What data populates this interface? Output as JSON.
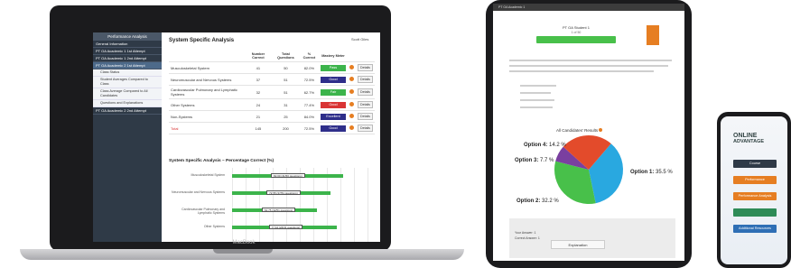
{
  "colors": {
    "pass": "#3cb44b",
    "good": "#2e2e8a",
    "fair": "#3cb44b",
    "excellent": "#2e2e8a",
    "red": "#d93535",
    "orange": "#e67e22",
    "navy": "#2f3a47"
  },
  "laptop": {
    "brand": "MacBook",
    "sidebar_header": "Performance Analysis",
    "sidebar_items": [
      {
        "label": "General Information",
        "active": false
      },
      {
        "label": "PT OA Academic 1 1st Attempt",
        "active": false
      },
      {
        "label": "PT OA Academic 1 2nd Attempt",
        "active": false
      },
      {
        "label": "PT OA Academic 2 1st Attempt",
        "active": true
      }
    ],
    "sidebar_subitems": [
      "Class Status",
      "Student Averages Compared to Class",
      "Class Average Compared to All Candidates",
      "Questions and Explanations"
    ],
    "sidebar_items_bottom": [
      {
        "label": "PT OA Academic 2 2nd Attempt"
      }
    ],
    "title": "System Specific Analysis",
    "user": "Scott Giles",
    "table": {
      "headers": [
        "",
        "Number Correct",
        "Total Questions",
        "% Correct",
        "Mastery Meter",
        "",
        ""
      ],
      "rows": [
        {
          "system": "Musculoskeletal System",
          "correct": "41",
          "total": "50",
          "pct": "82.0%",
          "mastery": "Pass",
          "color": "#3cb44b",
          "details": "Details"
        },
        {
          "system": "Neuromuscular and Nervous Systems",
          "correct": "37",
          "total": "51",
          "pct": "72.5%",
          "mastery": "Good",
          "color": "#2e2e8a",
          "details": "Details"
        },
        {
          "system": "Cardiovascular Pulmonary and Lymphatic Systems",
          "correct": "32",
          "total": "51",
          "pct": "62.7%",
          "mastery": "Fair",
          "color": "#3cb44b",
          "details": "Details"
        },
        {
          "system": "Other Systems",
          "correct": "24",
          "total": "31",
          "pct": "77.4%",
          "mastery": "Good",
          "color": "#d93535",
          "details": "Details"
        },
        {
          "system": "Non-Systems",
          "correct": "21",
          "total": "25",
          "pct": "84.0%",
          "mastery": "Excellent",
          "color": "#2e2e8a",
          "details": "Details"
        },
        {
          "system": "Total",
          "correct": "145",
          "total": "200",
          "pct": "72.5%",
          "mastery": "Good",
          "color": "#2e2e8a",
          "details": "Details",
          "total_row": true
        }
      ]
    },
    "bar_section_title": "System Specific Analysis – Percentage Correct (%)",
    "bars": [
      {
        "label": "Musculoskeletal System",
        "value": 82,
        "tag": "82.00 (41/50 questions)"
      },
      {
        "label": "Neuromuscular and Nervous Systems",
        "value": 72.5,
        "tag": "72.55 (37/51 questions)"
      },
      {
        "label": "Cardiovascular Pulmonary and Lymphatic Systems",
        "value": 62.7,
        "tag": "62.75 (32/51 questions)"
      },
      {
        "label": "Other Systems",
        "value": 77.4,
        "tag": "77.42 (24/31 questions)"
      }
    ]
  },
  "tablet": {
    "header_text": "PT OA Academic 1",
    "question_title": "PT OA Student 1",
    "question_sub": "1 of 50",
    "results_title": "All Candidates' Results",
    "pie": [
      {
        "label": "Option 1",
        "pct": 35.5,
        "display": "35.5 %",
        "color": "#29a8e0"
      },
      {
        "label": "Option 2",
        "pct": 32.2,
        "display": "32.2 %",
        "color": "#48c04a"
      },
      {
        "label": "Option 3",
        "pct": 7.7,
        "display": "7.7 %",
        "color": "#7a3fa0"
      },
      {
        "label": "Option 4",
        "pct": 24.6,
        "display": "14.2 %",
        "color": "#e34b2b"
      }
    ],
    "panel_lines": [
      "Your Answer: 1",
      "Correct Answer: 1"
    ],
    "panel_button": "Explanation"
  },
  "phone": {
    "logo_line1": "ONLINE",
    "logo_line2": "ADVANTAGE",
    "buttons": [
      {
        "label": "Course",
        "color": "#2f3a47"
      },
      {
        "label": "Performance",
        "color": "#e67e22"
      },
      {
        "label": "Performance Analysis",
        "color": "#e67e22"
      },
      {
        "label": "",
        "color": "#2e8b57"
      },
      {
        "label": "Additional Resources",
        "color": "#2f6fb5"
      }
    ]
  }
}
